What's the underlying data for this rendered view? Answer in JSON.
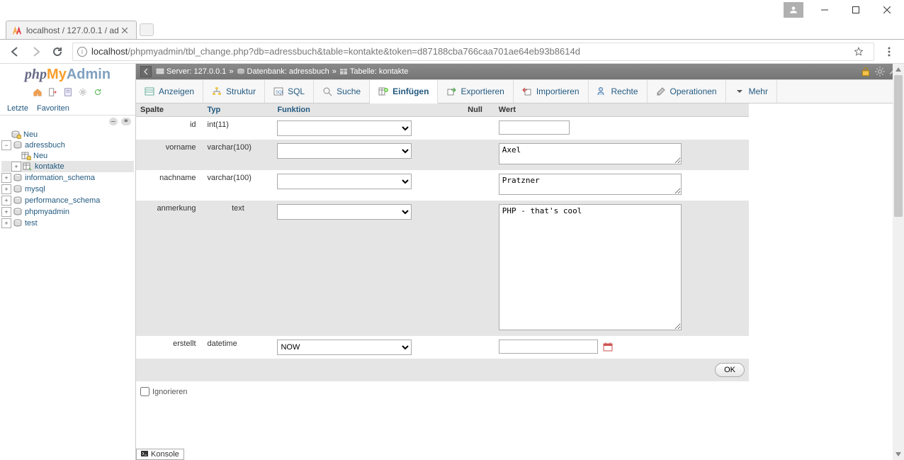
{
  "browser": {
    "tab_title": "localhost / 127.0.0.1 / ad",
    "url_host": "localhost",
    "url_path": "/phpmyadmin/tbl_change.php?db=adressbuch&table=kontakte&token=d87188cba766caa701ae64eb93b8614d"
  },
  "sidebar": {
    "tabs": {
      "recent": "Letzte",
      "favorites": "Favoriten"
    },
    "new_label": "Neu",
    "dbs": {
      "adressbuch": "adressbuch",
      "adressbuch_new": "Neu",
      "kontakte": "kontakte",
      "information_schema": "information_schema",
      "mysql": "mysql",
      "performance_schema": "performance_schema",
      "phpmyadmin": "phpmyadmin",
      "test": "test"
    }
  },
  "breadcrumb": {
    "server_label": "Server:",
    "server": "127.0.0.1",
    "db_label": "Datenbank:",
    "db": "adressbuch",
    "table_label": "Tabelle:",
    "table": "kontakte"
  },
  "topnav": {
    "anzeigen": "Anzeigen",
    "struktur": "Struktur",
    "sql": "SQL",
    "suche": "Suche",
    "einfuegen": "Einfügen",
    "exportieren": "Exportieren",
    "importieren": "Importieren",
    "rechte": "Rechte",
    "operationen": "Operationen",
    "mehr": "Mehr"
  },
  "table": {
    "headers": {
      "spalte": "Spalte",
      "typ": "Typ",
      "funktion": "Funktion",
      "null": "Null",
      "wert": "Wert"
    },
    "rows": [
      {
        "spalte": "id",
        "typ": "int(11)",
        "funktion": "",
        "wert": ""
      },
      {
        "spalte": "vorname",
        "typ": "varchar(100)",
        "funktion": "",
        "wert": "Axel"
      },
      {
        "spalte": "nachname",
        "typ": "varchar(100)",
        "funktion": "",
        "wert": "Pratzner"
      },
      {
        "spalte": "anmerkung",
        "typ": "text",
        "funktion": "",
        "wert": "PHP - that's cool"
      },
      {
        "spalte": "erstellt",
        "typ": "datetime",
        "funktion": "NOW",
        "wert": ""
      }
    ]
  },
  "buttons": {
    "ok": "OK"
  },
  "footer": {
    "ignorieren": "Ignorieren",
    "konsole": "Konsole"
  },
  "colors": {
    "pma_orange": "#f89e2b",
    "pma_blue": "#7fa1c0",
    "link": "#235a81"
  }
}
